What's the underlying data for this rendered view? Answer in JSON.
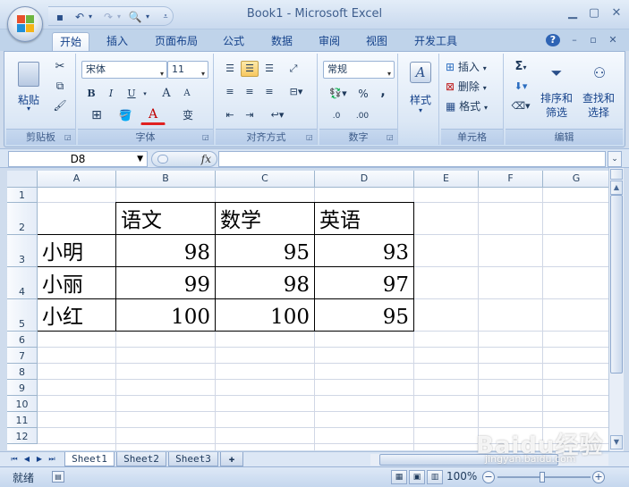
{
  "window": {
    "title": "Book1 - Microsoft Excel"
  },
  "ribbon": {
    "tabs": [
      "开始",
      "插入",
      "页面布局",
      "公式",
      "数据",
      "审阅",
      "视图",
      "开发工具"
    ],
    "active_tab": "开始",
    "clipboard": {
      "paste": "粘贴",
      "label": "剪贴板"
    },
    "font": {
      "name": "宋体",
      "size": "11",
      "label": "字体",
      "bold": "B",
      "italic": "I",
      "underline": "U",
      "grow": "A",
      "shrink": "A",
      "color_a": "A",
      "phonetic": "变"
    },
    "alignment": {
      "label": "对齐方式"
    },
    "number": {
      "format": "常规",
      "label": "数字",
      "percent": "%",
      "comma": ",",
      "inc_dec": ".0",
      "dec_dec": ".00"
    },
    "styles": {
      "label": "样式"
    },
    "cells": {
      "insert": "插入",
      "delete": "删除",
      "format": "格式",
      "label": "单元格"
    },
    "editing": {
      "sigma": "Σ",
      "sort_filter": "排序和",
      "sort_filter2": "筛选",
      "find_select": "查找和",
      "find_select2": "选择",
      "label": "编辑"
    }
  },
  "formula_bar": {
    "name_box": "D8",
    "fx": "fx",
    "formula": ""
  },
  "sheet": {
    "columns": [
      "A",
      "B",
      "C",
      "D",
      "E",
      "F",
      "G"
    ],
    "rows": [
      "1",
      "2",
      "3",
      "4",
      "5",
      "6",
      "7",
      "8",
      "9",
      "10",
      "11",
      "12"
    ],
    "table": {
      "header": [
        "",
        "语文",
        "数学",
        "英语"
      ],
      "data": [
        [
          "小明",
          "98",
          "95",
          "93"
        ],
        [
          "小丽",
          "99",
          "98",
          "97"
        ],
        [
          "小红",
          "100",
          "100",
          "95"
        ]
      ]
    }
  },
  "sheet_tabs": [
    "Sheet1",
    "Sheet2",
    "Sheet3"
  ],
  "status": {
    "text": "就绪",
    "zoom": "100%"
  },
  "watermark": {
    "text": "Baidu经验",
    "sub": "jingyan.baidu.com"
  }
}
